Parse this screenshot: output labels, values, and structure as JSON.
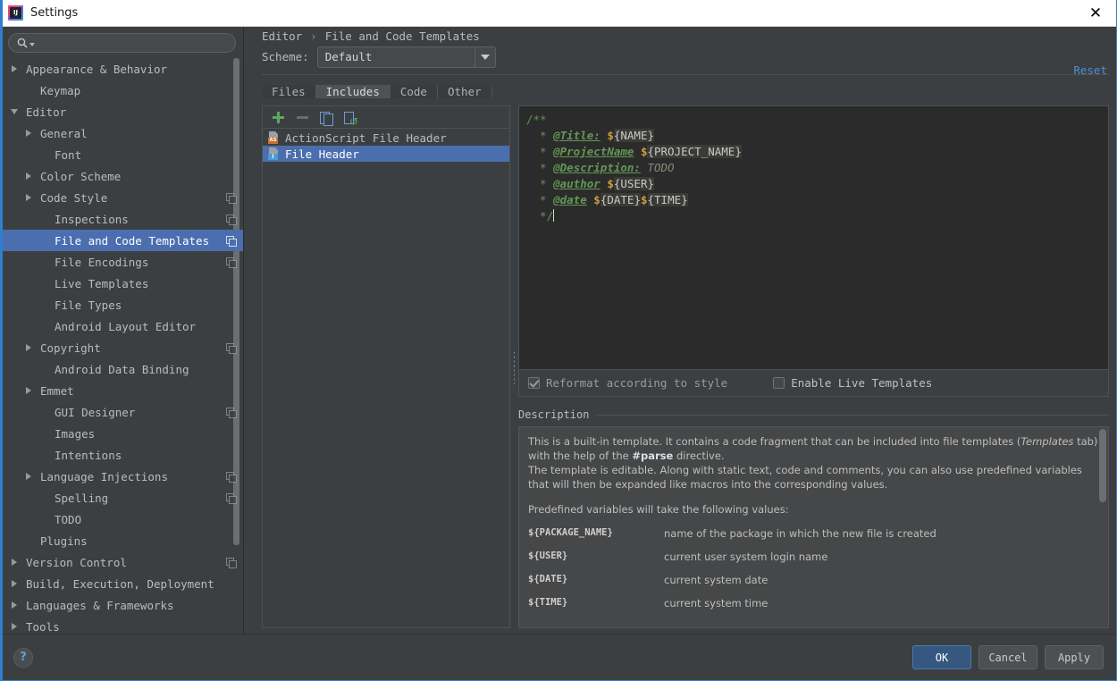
{
  "window": {
    "title": "Settings",
    "app_icon": "intellij-icon",
    "close_icon": "✕"
  },
  "search": {
    "value": "",
    "placeholder": "",
    "icon": "search-icon"
  },
  "sidebar": {
    "items": [
      {
        "label": "Appearance & Behavior",
        "arrow": "collapsed",
        "indent": 0,
        "copy": false,
        "selected": false
      },
      {
        "label": "Keymap",
        "arrow": "none",
        "indent": 1,
        "copy": false,
        "selected": false
      },
      {
        "label": "Editor",
        "arrow": "expanded",
        "indent": 0,
        "copy": false,
        "selected": false
      },
      {
        "label": "General",
        "arrow": "collapsed",
        "indent": 1,
        "copy": false,
        "selected": false
      },
      {
        "label": "Font",
        "arrow": "none",
        "indent": 2,
        "copy": false,
        "selected": false
      },
      {
        "label": "Color Scheme",
        "arrow": "collapsed",
        "indent": 1,
        "copy": false,
        "selected": false
      },
      {
        "label": "Code Style",
        "arrow": "collapsed",
        "indent": 1,
        "copy": true,
        "selected": false
      },
      {
        "label": "Inspections",
        "arrow": "none",
        "indent": 2,
        "copy": true,
        "selected": false
      },
      {
        "label": "File and Code Templates",
        "arrow": "none",
        "indent": 2,
        "copy": true,
        "selected": true
      },
      {
        "label": "File Encodings",
        "arrow": "none",
        "indent": 2,
        "copy": true,
        "selected": false
      },
      {
        "label": "Live Templates",
        "arrow": "none",
        "indent": 2,
        "copy": false,
        "selected": false
      },
      {
        "label": "File Types",
        "arrow": "none",
        "indent": 2,
        "copy": false,
        "selected": false
      },
      {
        "label": "Android Layout Editor",
        "arrow": "none",
        "indent": 2,
        "copy": false,
        "selected": false
      },
      {
        "label": "Copyright",
        "arrow": "collapsed",
        "indent": 1,
        "copy": true,
        "selected": false
      },
      {
        "label": "Android Data Binding",
        "arrow": "none",
        "indent": 2,
        "copy": false,
        "selected": false
      },
      {
        "label": "Emmet",
        "arrow": "collapsed",
        "indent": 1,
        "copy": false,
        "selected": false
      },
      {
        "label": "GUI Designer",
        "arrow": "none",
        "indent": 2,
        "copy": true,
        "selected": false
      },
      {
        "label": "Images",
        "arrow": "none",
        "indent": 2,
        "copy": false,
        "selected": false
      },
      {
        "label": "Intentions",
        "arrow": "none",
        "indent": 2,
        "copy": false,
        "selected": false
      },
      {
        "label": "Language Injections",
        "arrow": "collapsed",
        "indent": 1,
        "copy": true,
        "selected": false
      },
      {
        "label": "Spelling",
        "arrow": "none",
        "indent": 2,
        "copy": true,
        "selected": false
      },
      {
        "label": "TODO",
        "arrow": "none",
        "indent": 2,
        "copy": false,
        "selected": false
      },
      {
        "label": "Plugins",
        "arrow": "none",
        "indent": 1,
        "copy": false,
        "selected": false
      },
      {
        "label": "Version Control",
        "arrow": "collapsed",
        "indent": 0,
        "copy": true,
        "selected": false
      },
      {
        "label": "Build, Execution, Deployment",
        "arrow": "collapsed",
        "indent": 0,
        "copy": false,
        "selected": false
      },
      {
        "label": "Languages & Frameworks",
        "arrow": "collapsed",
        "indent": 0,
        "copy": false,
        "selected": false
      },
      {
        "label": "Tools",
        "arrow": "collapsed",
        "indent": 0,
        "copy": false,
        "selected": false
      }
    ]
  },
  "breadcrumb": {
    "parent": "Editor",
    "separator": "›",
    "current": "File and Code Templates"
  },
  "reset_link": "Reset",
  "scheme": {
    "label": "Scheme:",
    "value": "Default",
    "dropdown_icon": "chevron-down-icon"
  },
  "tabs": [
    {
      "label": "Files",
      "active": false
    },
    {
      "label": "Includes",
      "active": true
    },
    {
      "label": "Code",
      "active": false
    },
    {
      "label": "Other",
      "active": false
    }
  ],
  "list_toolbar": [
    {
      "icon": "add-icon",
      "name": "add-template-button"
    },
    {
      "icon": "remove-icon",
      "name": "remove-template-button"
    },
    {
      "icon": "copy-icon",
      "name": "copy-template-button"
    },
    {
      "icon": "reset-icon",
      "name": "reset-template-button"
    }
  ],
  "templates": [
    {
      "label": "ActionScript File Header",
      "badge": "AS",
      "badge_color": "#c9702a",
      "selected": false
    },
    {
      "label": "File Header",
      "badge": "J",
      "badge_color": "#4c9bd4",
      "selected": true
    }
  ],
  "editor": {
    "lines": [
      {
        "segments": [
          {
            "t": "/**",
            "k": "cmt"
          }
        ]
      },
      {
        "segments": [
          {
            "t": "  * ",
            "k": "cmt"
          },
          {
            "t": "@Title:",
            "k": "tag"
          },
          {
            "t": " ",
            "k": "cmt"
          },
          {
            "t": "$",
            "k": "dollar"
          },
          {
            "t": "{NAME}",
            "k": "varname"
          }
        ]
      },
      {
        "segments": [
          {
            "t": "  * ",
            "k": "cmt"
          },
          {
            "t": "@ProjectName",
            "k": "tag"
          },
          {
            "t": " ",
            "k": "cmt"
          },
          {
            "t": "$",
            "k": "dollar"
          },
          {
            "t": "{PROJECT_NAME}",
            "k": "varname"
          }
        ]
      },
      {
        "segments": [
          {
            "t": "  * ",
            "k": "cmt"
          },
          {
            "t": "@Description:",
            "k": "tag"
          },
          {
            "t": " ",
            "k": "cmt"
          },
          {
            "t": "TODO",
            "k": "todo"
          }
        ]
      },
      {
        "segments": [
          {
            "t": "  * ",
            "k": "cmt"
          },
          {
            "t": "@author",
            "k": "tag"
          },
          {
            "t": " ",
            "k": "cmt"
          },
          {
            "t": "$",
            "k": "dollar"
          },
          {
            "t": "{USER}",
            "k": "varname"
          }
        ]
      },
      {
        "segments": [
          {
            "t": "  * ",
            "k": "cmt"
          },
          {
            "t": "@date",
            "k": "tag"
          },
          {
            "t": " ",
            "k": "cmt"
          },
          {
            "t": "$",
            "k": "dollar"
          },
          {
            "t": "{DATE}",
            "k": "varname"
          },
          {
            "t": "$",
            "k": "dollar"
          },
          {
            "t": "{TIME}",
            "k": "varname"
          }
        ]
      },
      {
        "segments": [
          {
            "t": "  */",
            "k": "cmt"
          }
        ],
        "caret": true
      }
    ]
  },
  "options": {
    "reformat": {
      "label": "Reformat according to style",
      "checked": true,
      "enabled": false
    },
    "live_templates": {
      "label": "Enable Live Templates",
      "checked": false,
      "enabled": true
    }
  },
  "description": {
    "header": "Description",
    "paragraphs": [
      "This is a built-in template. It contains a code fragment that can be included into file templates (Templates tab) with the help of the #parse directive.",
      "The template is editable. Along with static text, code and comments, you can also use predefined variables that will then be expanded like macros into the corresponding values.",
      "Predefined variables will take the following values:"
    ],
    "variables": [
      {
        "name": "${PACKAGE_NAME}",
        "desc": "name of the package in which the new file is created"
      },
      {
        "name": "${USER}",
        "desc": "current user system login name"
      },
      {
        "name": "${DATE}",
        "desc": "current system date"
      },
      {
        "name": "${TIME}",
        "desc": "current system time"
      }
    ]
  },
  "footer": {
    "help_label": "?",
    "ok": "OK",
    "cancel": "Cancel",
    "apply": "Apply"
  },
  "colors": {
    "accent": "#4b6eaf",
    "link": "#4b8fd1",
    "primary_button": "#365880",
    "editor_bg": "#2b2b2b",
    "comment_green": "#629755",
    "var_gold": "#c8a03a"
  }
}
